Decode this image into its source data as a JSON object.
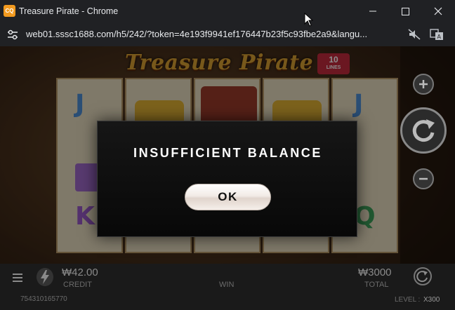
{
  "window": {
    "app_icon_text": "CQ",
    "title": "Treasure Pirate - Chrome",
    "minimize_icon": "minimize-icon",
    "maximize_icon": "maximize-icon",
    "close_icon": "close-icon"
  },
  "addressbar": {
    "site_info_icon": "tune-icon",
    "url": "web01.sssc1688.com/h5/242/?token=4e193f9941ef176447b23f5c93fbe2a9&langu...",
    "icons": [
      "muted-icon",
      "translate-icon"
    ]
  },
  "game": {
    "logo": "Treasure Pirate",
    "lines_badge": {
      "number": "10",
      "label": "LINES"
    },
    "controls": {
      "plus_icon": "plus-icon",
      "spin_icon": "refresh-icon",
      "minus_icon": "minus-icon"
    },
    "symbols": [
      "J",
      "K",
      "J",
      "Q"
    ],
    "bottombar": {
      "menu_icon": "hamburger-icon",
      "turbo_icon": "lightning-icon",
      "credit_value": "₩42.00",
      "credit_label": "CREDIT",
      "win_label": "WIN",
      "total_value": "₩3000",
      "total_label": "TOTAL",
      "autospin_icon": "autospin-icon",
      "account_id": "754310165770",
      "level_label": "LEVEL :",
      "level_value": "X300"
    }
  },
  "modal": {
    "title": "INSUFFICIENT BALANCE",
    "ok_label": "OK"
  },
  "colors": {
    "chrome_bg": "#202124",
    "app_icon": "#f29a1f",
    "modal_bg": "#0c0c0c",
    "lines_badge": "#c42b3c"
  }
}
